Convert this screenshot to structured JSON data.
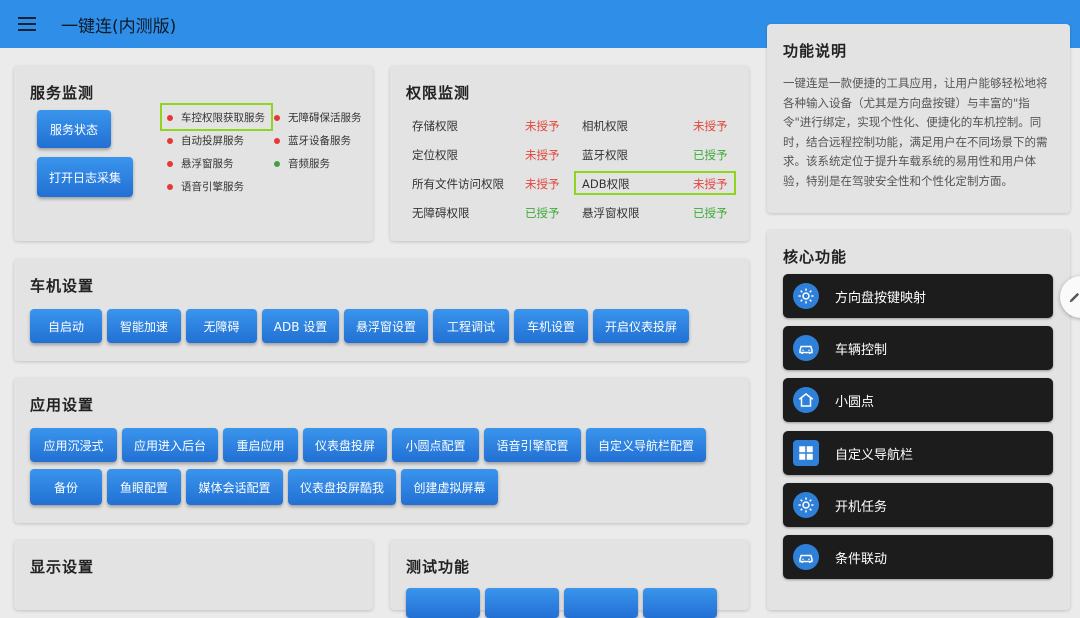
{
  "app": {
    "title": "一键连(内测版)"
  },
  "service_monitor": {
    "title": "服务监测",
    "buttons": {
      "service_status": "服务状态",
      "open_log": "打开日志采集"
    },
    "services": [
      {
        "label": "车控权限获取服务",
        "status_color": "#e53935"
      },
      {
        "label": "无障碍保活服务",
        "status_color": "#e53935"
      },
      {
        "label": "自动投屏服务",
        "status_color": "#e53935"
      },
      {
        "label": "蓝牙设备服务",
        "status_color": "#e53935"
      },
      {
        "label": "悬浮窗服务",
        "status_color": "#e53935"
      },
      {
        "label": "音频服务",
        "status_color": "#43a047"
      },
      {
        "label": "语音引擎服务",
        "status_color": "#e53935"
      }
    ]
  },
  "permission_monitor": {
    "title": "权限监测",
    "rows": [
      {
        "name": "存储权限",
        "status": "未授予"
      },
      {
        "name": "相机权限",
        "status": "未授予"
      },
      {
        "name": "定位权限",
        "status": "未授予"
      },
      {
        "name": "蓝牙权限",
        "status": "已授予"
      },
      {
        "name": "所有文件访问权限",
        "status": "未授予"
      },
      {
        "name": "ADB权限",
        "status": "未授予"
      },
      {
        "name": "无障碍权限",
        "status": "已授予"
      },
      {
        "name": "悬浮窗权限",
        "status": "已授予"
      }
    ]
  },
  "car_settings": {
    "title": "车机设置",
    "buttons": [
      "自启动",
      "智能加速",
      "无障碍",
      "ADB 设置",
      "悬浮窗设置",
      "工程调试",
      "车机设置",
      "开启仪表投屏"
    ]
  },
  "app_settings": {
    "title": "应用设置",
    "buttons": [
      "应用沉浸式",
      "应用进入后台",
      "重启应用",
      "仪表盘投屏",
      "小圆点配置",
      "语音引擎配置",
      "自定义导航栏配置",
      "备份",
      "鱼眼配置",
      "媒体会话配置",
      "仪表盘投屏酷我",
      "创建虚拟屏幕"
    ]
  },
  "display_settings": {
    "title": "显示设置"
  },
  "test_functions": {
    "title": "测试功能"
  },
  "function_desc": {
    "title": "功能说明",
    "text": "一键连是一款便捷的工具应用，让用户能够轻松地将各种输入设备（尤其是方向盘按键）与丰富的\"指令\"进行绑定，实现个性化、便捷化的车机控制。同时，结合远程控制功能，满足用户在不同场景下的需求。该系统定位于提升车载系统的易用性和用户体验，特别是在驾驶安全性和个性化定制方面。"
  },
  "core_functions": {
    "title": "核心功能",
    "items": [
      {
        "label": "方向盘按键映射",
        "icon": "gear-icon"
      },
      {
        "label": "车辆控制",
        "icon": "car-icon"
      },
      {
        "label": "小圆点",
        "icon": "home-icon"
      },
      {
        "label": "自定义导航栏",
        "icon": "grid-icon"
      },
      {
        "label": "开机任务",
        "icon": "gear-icon"
      },
      {
        "label": "条件联动",
        "icon": "car-icon"
      }
    ]
  },
  "colors": {
    "accent": "#2f8fe8",
    "granted": "#3caa3a",
    "denied": "#e2453a",
    "highlight": "#8fd420"
  }
}
